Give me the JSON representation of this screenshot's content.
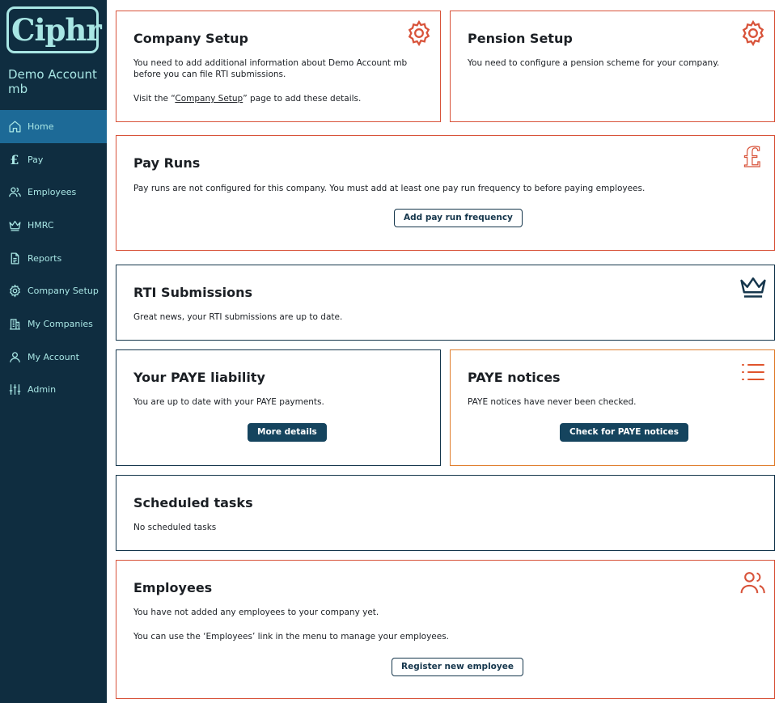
{
  "sidebar": {
    "logo": "Ciphr",
    "company_name": "Demo Account mb",
    "items": [
      {
        "label": "Home",
        "icon": "home-icon"
      },
      {
        "label": "Pay",
        "icon": "pound-icon"
      },
      {
        "label": "Employees",
        "icon": "users-icon"
      },
      {
        "label": "HMRC",
        "icon": "crown-icon"
      },
      {
        "label": "Reports",
        "icon": "document-icon"
      },
      {
        "label": "Company Setup",
        "icon": "gear-icon"
      },
      {
        "label": "My Companies",
        "icon": "buildings-icon"
      },
      {
        "label": "My Account",
        "icon": "user-icon"
      },
      {
        "label": "Admin",
        "icon": "sliders-icon"
      }
    ],
    "active_index": 0
  },
  "cards": {
    "company_setup": {
      "title": "Company Setup",
      "text1": "You need to add additional information about Demo Account mb before you can file RTI submissions.",
      "text2_prefix": "Visit the “",
      "text2_link": "Company Setup",
      "text2_suffix": "” page to add these details."
    },
    "pension_setup": {
      "title": "Pension Setup",
      "text": "You need to configure a pension scheme for your company."
    },
    "pay_runs": {
      "title": "Pay Runs",
      "text": "Pay runs are not configured for this company. You must add at least one pay run frequency to before paying employees.",
      "button": "Add pay run frequency"
    },
    "rti": {
      "title": "RTI Submissions",
      "text": "Great news, your RTI submissions are up to date."
    },
    "paye_liability": {
      "title": "Your PAYE liability",
      "text": "You are up to date with your PAYE payments.",
      "button": "More details"
    },
    "paye_notices": {
      "title": "PAYE notices",
      "text": "PAYE notices have never been checked.",
      "button": "Check for PAYE notices"
    },
    "scheduled": {
      "title": "Scheduled tasks",
      "text": "No scheduled tasks"
    },
    "employees": {
      "title": "Employees",
      "text1": "You have not added any employees to your company yet.",
      "text2": "You can use the ‘Employees’ link in the menu to manage your employees.",
      "button": "Register new employee"
    }
  },
  "colors": {
    "sidebar_bg": "#0f2d40",
    "sidebar_text": "#a8e6e4",
    "active_item": "#1d6a97",
    "alert_border": "#d8533a",
    "ok_border": "#15364c",
    "notice_border": "#e07e2e",
    "button_primary": "#15445e"
  }
}
